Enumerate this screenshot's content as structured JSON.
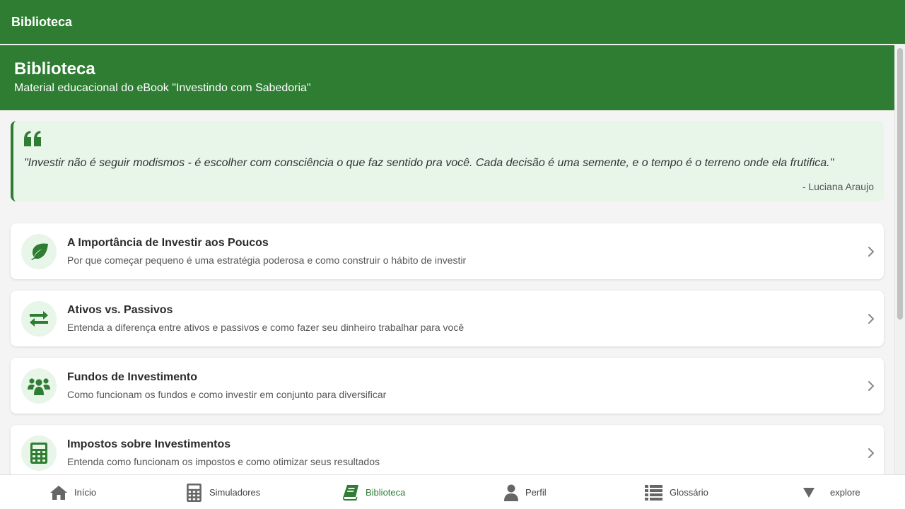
{
  "topbar": {
    "title": "Biblioteca"
  },
  "header": {
    "title": "Biblioteca",
    "subtitle": "Material educacional do eBook \"Investindo com Sabedoria\""
  },
  "quote": {
    "icon": "quote-icon",
    "text": "\"Investir não é seguir modismos - é escolher com consciência o que faz sentido pra você. Cada decisão é uma semente, e o tempo é o terreno onde ela frutifica.\"",
    "author": "- Luciana Araujo"
  },
  "cards": [
    {
      "icon": "leaf-icon",
      "title": "A Importância de Investir aos Poucos",
      "desc": "Por que começar pequeno é uma estratégia poderosa e como construir o hábito de investir"
    },
    {
      "icon": "exchange-icon",
      "title": "Ativos vs. Passivos",
      "desc": "Entenda a diferença entre ativos e passivos e como fazer seu dinheiro trabalhar para você"
    },
    {
      "icon": "users-icon",
      "title": "Fundos de Investimento",
      "desc": "Como funcionam os fundos e como investir em conjunto para diversificar"
    },
    {
      "icon": "calculator-icon",
      "title": "Impostos sobre Investimentos",
      "desc": "Entenda como funcionam os impostos e como otimizar seus resultados"
    }
  ],
  "nav": [
    {
      "icon": "home-icon",
      "label": "Início",
      "active": false
    },
    {
      "icon": "calculator-icon",
      "label": "Simuladores",
      "active": false
    },
    {
      "icon": "book-icon",
      "label": "Biblioteca",
      "active": true
    },
    {
      "icon": "user-icon",
      "label": "Perfil",
      "active": false
    },
    {
      "icon": "list-icon",
      "label": "Glossário",
      "active": false
    },
    {
      "icon": "triangle-down-icon",
      "label": "explore",
      "active": false
    }
  ],
  "colors": {
    "primary": "#2e7d32",
    "light_green": "#e8f5e9",
    "nav_icon": "#666666"
  }
}
